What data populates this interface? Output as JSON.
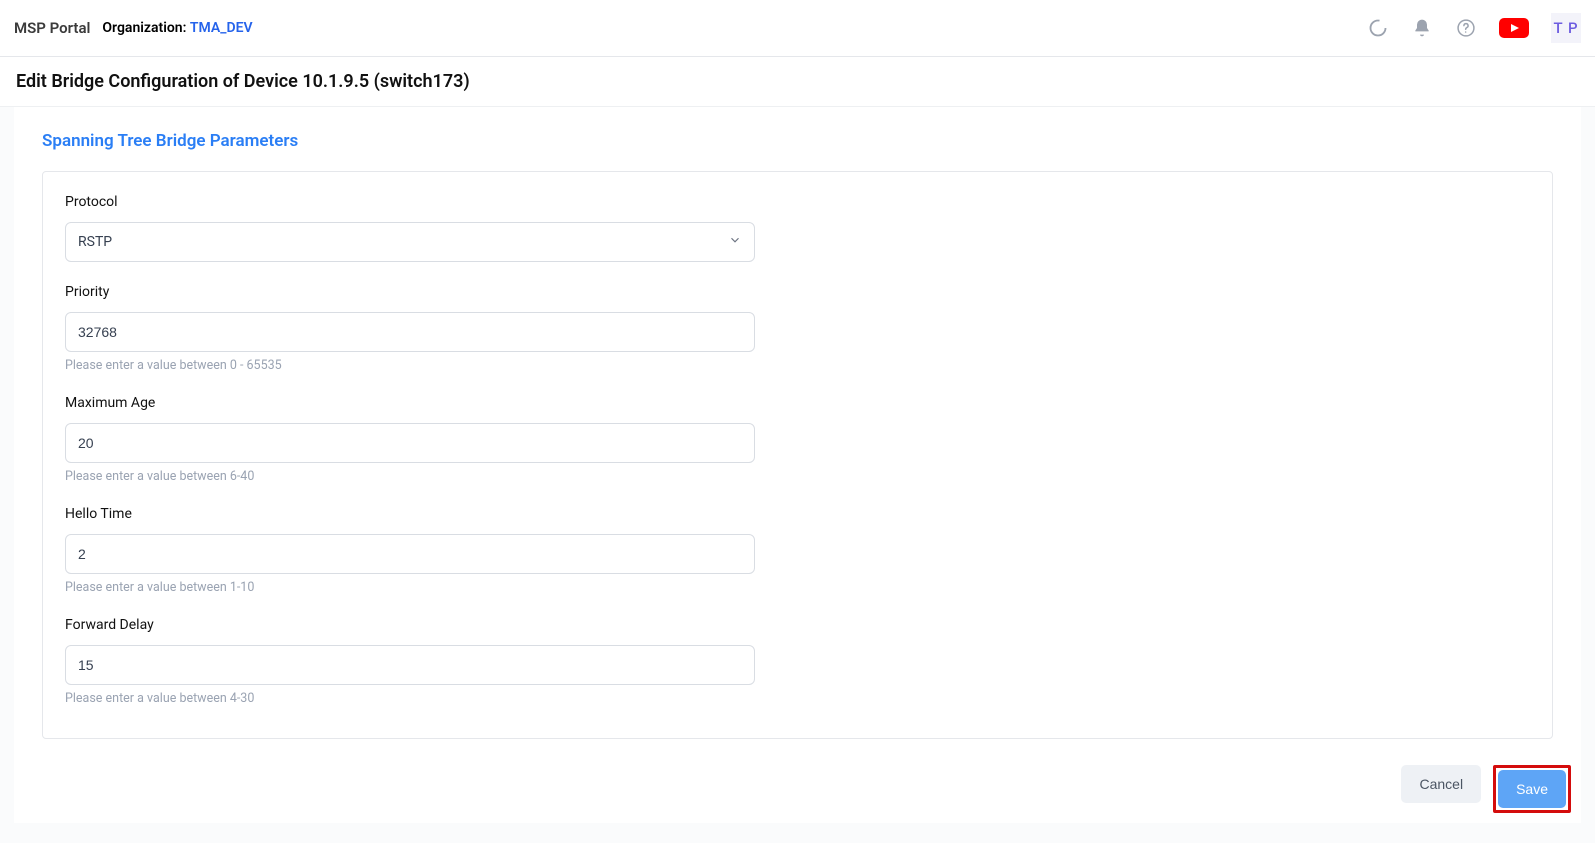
{
  "header": {
    "brand": "MSP Portal",
    "org_label": "Organization:",
    "org_value": "TMA_DEV",
    "avatar_initials": "T P"
  },
  "page": {
    "title": "Edit Bridge Configuration of Device 10.1.9.5 (switch173)"
  },
  "panel": {
    "title": "Spanning Tree Bridge Parameters"
  },
  "form": {
    "protocol": {
      "label": "Protocol",
      "value": "RSTP"
    },
    "priority": {
      "label": "Priority",
      "value": "32768",
      "help": "Please enter a value between 0 - 65535"
    },
    "maximum_age": {
      "label": "Maximum Age",
      "value": "20",
      "help": "Please enter a value between 6-40"
    },
    "hello_time": {
      "label": "Hello Time",
      "value": "2",
      "help": "Please enter a value between 1-10"
    },
    "forward_delay": {
      "label": "Forward Delay",
      "value": "15",
      "help": "Please enter a value between 4-30"
    }
  },
  "actions": {
    "cancel": "Cancel",
    "save": "Save"
  }
}
